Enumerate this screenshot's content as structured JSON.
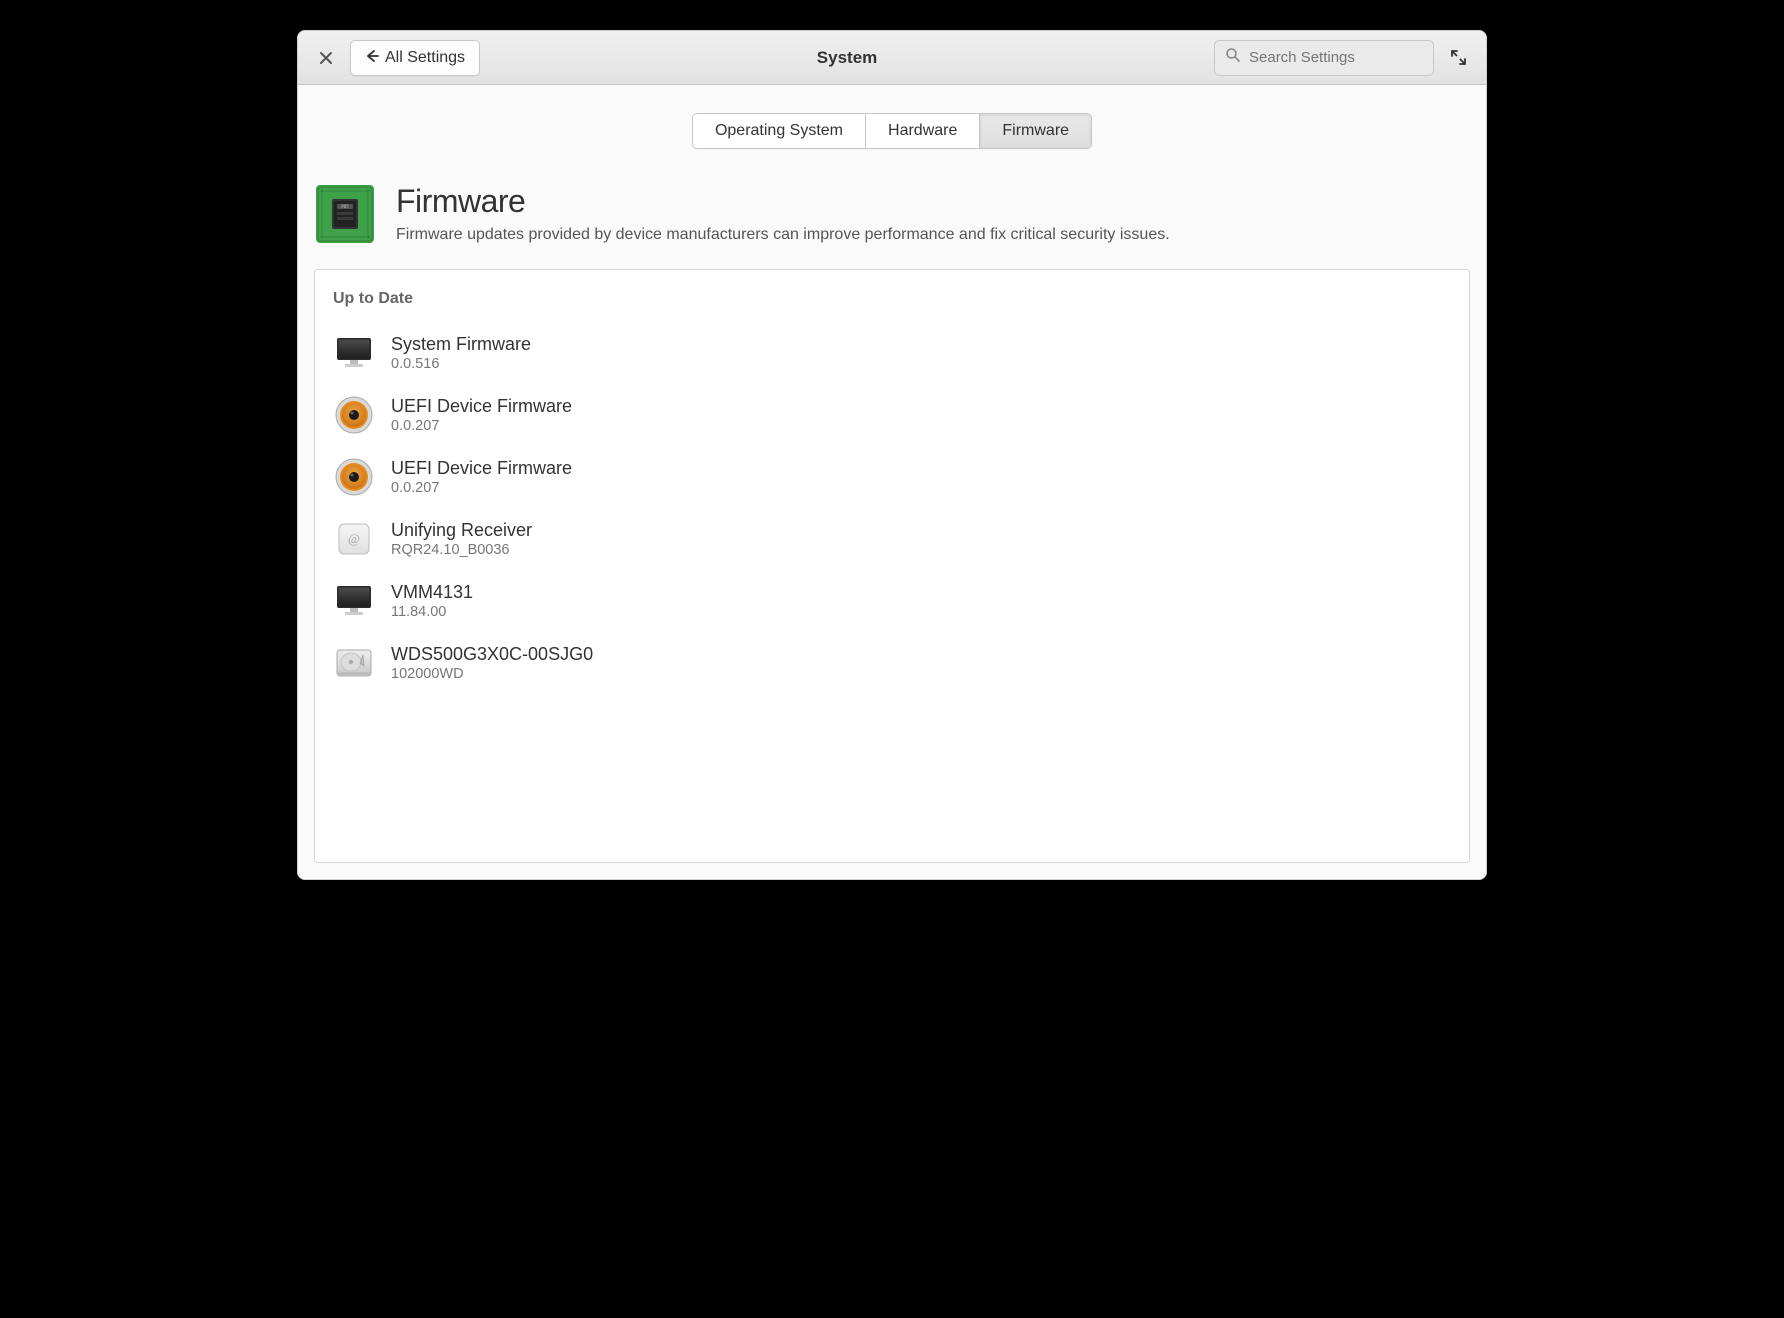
{
  "header": {
    "title": "System",
    "back_label": "All Settings",
    "search_placeholder": "Search Settings"
  },
  "tabs": [
    {
      "label": "Operating System",
      "active": false
    },
    {
      "label": "Hardware",
      "active": false
    },
    {
      "label": "Firmware",
      "active": true
    }
  ],
  "hero": {
    "title": "Firmware",
    "subtitle": "Firmware updates provided by device manufacturers can improve performance and fix critical security issues."
  },
  "section_title": "Up to Date",
  "devices": [
    {
      "icon": "monitor",
      "name": "System Firmware",
      "version": "0.0.516"
    },
    {
      "icon": "speaker",
      "name": "UEFI Device Firmware",
      "version": "0.0.207"
    },
    {
      "icon": "speaker",
      "name": "UEFI Device Firmware",
      "version": "0.0.207"
    },
    {
      "icon": "receiver",
      "name": "Unifying Receiver",
      "version": "RQR24.10_B0036"
    },
    {
      "icon": "monitor",
      "name": "VMM4131",
      "version": "11.84.00"
    },
    {
      "icon": "drive",
      "name": "WDS500G3X0C-00SJG0",
      "version": "102000WD"
    }
  ]
}
